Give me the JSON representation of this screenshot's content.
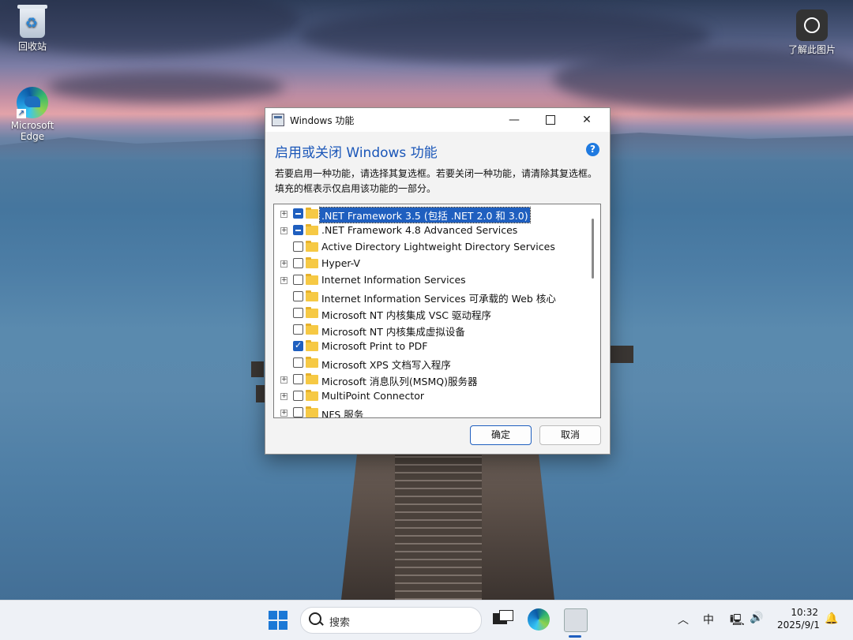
{
  "desktop": {
    "icons": [
      {
        "label": "回收站"
      },
      {
        "label": "Microsoft Edge"
      },
      {
        "label": "了解此图片"
      }
    ]
  },
  "dialog": {
    "title": "Windows 功能",
    "controls": {
      "minimize": "—",
      "maximize": "",
      "close": "✕"
    },
    "heading": "启用或关闭 Windows 功能",
    "help": "?",
    "description": "若要启用一种功能，请选择其复选框。若要关闭一种功能，请清除其复选框。填充的框表示仅启用该功能的一部分。",
    "features": [
      {
        "label": ".NET Framework 3.5 (包括 .NET 2.0 和 3.0)",
        "expandable": true,
        "state": "partial",
        "selected": true
      },
      {
        "label": ".NET Framework 4.8 Advanced Services",
        "expandable": true,
        "state": "partial",
        "selected": false
      },
      {
        "label": "Active Directory Lightweight Directory Services",
        "expandable": false,
        "state": "unchecked",
        "selected": false
      },
      {
        "label": "Hyper-V",
        "expandable": true,
        "state": "unchecked",
        "selected": false
      },
      {
        "label": "Internet Information Services",
        "expandable": true,
        "state": "unchecked",
        "selected": false
      },
      {
        "label": "Internet Information Services 可承载的 Web 核心",
        "expandable": false,
        "state": "unchecked",
        "selected": false
      },
      {
        "label": "Microsoft NT 内核集成 VSC 驱动程序",
        "expandable": false,
        "state": "unchecked",
        "selected": false
      },
      {
        "label": "Microsoft NT 内核集成虚拟设备",
        "expandable": false,
        "state": "unchecked",
        "selected": false
      },
      {
        "label": "Microsoft Print to PDF",
        "expandable": false,
        "state": "checked",
        "selected": false
      },
      {
        "label": "Microsoft XPS 文档写入程序",
        "expandable": false,
        "state": "unchecked",
        "selected": false
      },
      {
        "label": "Microsoft 消息队列(MSMQ)服务器",
        "expandable": true,
        "state": "unchecked",
        "selected": false
      },
      {
        "label": "MultiPoint Connector",
        "expandable": true,
        "state": "unchecked",
        "selected": false
      },
      {
        "label": "NFS 服务",
        "expandable": true,
        "state": "unchecked",
        "selected": false
      }
    ],
    "ok_label": "确定",
    "cancel_label": "取消"
  },
  "taskbar": {
    "search_placeholder": "搜索",
    "tray": {
      "chevron": "︿",
      "ime": "中",
      "network": "🖳",
      "volume": "🔊"
    },
    "time": "10:32",
    "date": "2025/9/1",
    "notification": "🔔"
  },
  "colors": {
    "accent": "#1f5fbf",
    "heading": "#1a56b8"
  }
}
